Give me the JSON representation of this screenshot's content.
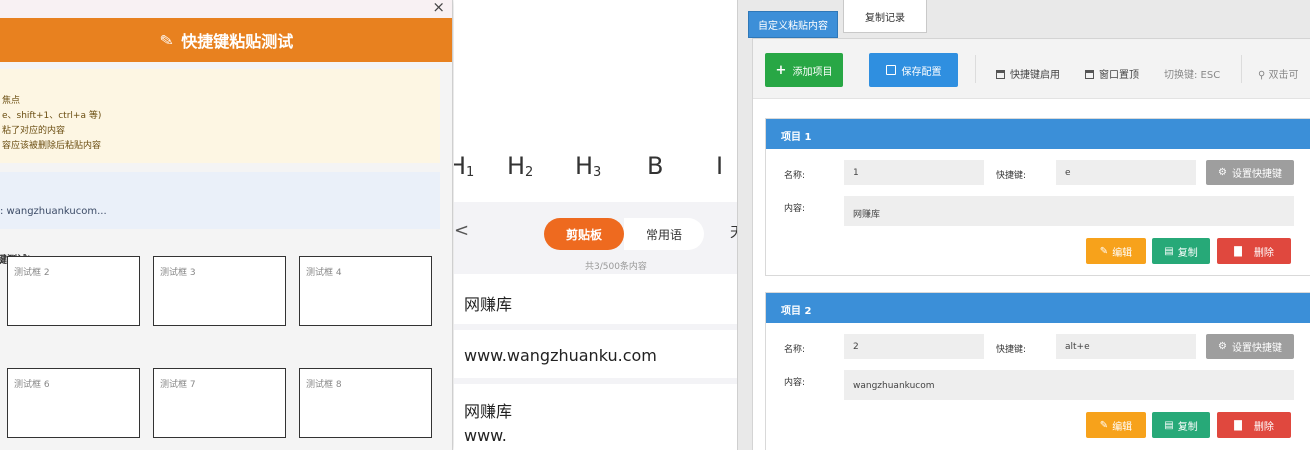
{
  "dialog": {
    "close_glyph": "×",
    "title": "快捷键粘贴测试",
    "tips": [
      "焦点",
      "e、shift+1、ctrl+a 等)",
      "粘了对应的内容",
      "容应该被删除后粘贴内容"
    ],
    "sample_text": ": wangzhuankucom...",
    "section_title": "键测试)：",
    "boxes": [
      "测试框 2",
      "测试框 3",
      "测试框 4",
      "测试框 6",
      "测试框 7",
      "测试框 8"
    ]
  },
  "clipboard": {
    "headings": [
      {
        "main": "H",
        "sub": "1"
      },
      {
        "main": "H",
        "sub": "2"
      },
      {
        "main": "H",
        "sub": "3"
      },
      {
        "main": "B",
        "sub": ""
      },
      {
        "main": "I",
        "sub": ""
      }
    ],
    "back_glyph": "<",
    "tab_clipboard": "剪贴板",
    "tab_common": "常用语",
    "tab_cut": "天",
    "count": "共3/500条内容",
    "items": [
      {
        "line1": "网赚库",
        "line2": ""
      },
      {
        "line1": "www.wangzhuanku.com",
        "line2": ""
      },
      {
        "line1": "网赚库",
        "line2": "www."
      }
    ]
  },
  "config": {
    "tabs": {
      "custom": "自定义粘贴内容",
      "history": "复制记录"
    },
    "toolbar": {
      "add": "添加项目",
      "save": "保存配置",
      "hotkey_enabled": "快捷键启用",
      "always_on_top": "窗口置顶",
      "toggle_hint": "切换键: ESC",
      "dblclick_hint": "双击可"
    },
    "labels": {
      "name": "名称:",
      "hotkey": "快捷键:",
      "content": "内容:"
    },
    "buttons": {
      "set_hotkey": "设置快捷键",
      "edit": "编辑",
      "copy": "复制",
      "delete": "删除"
    },
    "items": [
      {
        "title": "项目 1",
        "name": "1",
        "hotkey": "e",
        "content": "网赚库"
      },
      {
        "title": "项目 2",
        "name": "2",
        "hotkey": "alt+e",
        "content": "wangzhuankucom"
      }
    ]
  },
  "colors": {
    "dialog_banner": "#e8811f",
    "clip_active": "#ee6a1f",
    "card_header": "#3b8fd8",
    "btn_green": "#28a745",
    "btn_blue": "#2f8fe0",
    "btn_orange": "#f7a21b",
    "btn_teal": "#27a978",
    "btn_red": "#e0483e",
    "btn_gray": "#9e9e9e"
  }
}
